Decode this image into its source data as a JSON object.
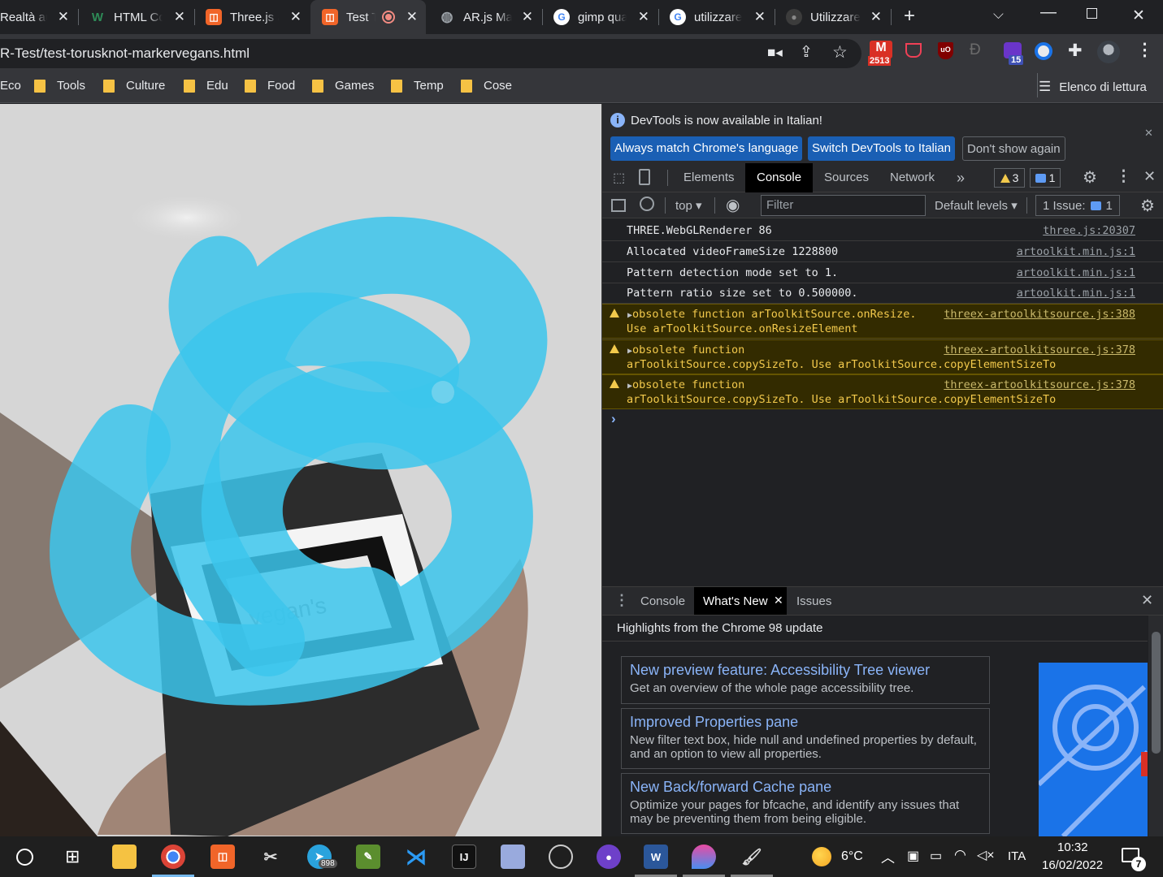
{
  "tabs": [
    {
      "title": "Realtà aumentata",
      "icon": "document-icon",
      "color": "#e8eaed"
    },
    {
      "title": "HTML Code",
      "icon": "w3-icon",
      "color": "#2e8b57"
    },
    {
      "title": "Three.js and",
      "icon": "three-icon",
      "color": "#f16529"
    },
    {
      "title": "Test TorusKnot",
      "icon": "three-icon",
      "color": "#f16529"
    },
    {
      "title": "AR.js Marker",
      "icon": "globe-icon",
      "color": "#9aa0a6"
    },
    {
      "title": "gimp quadrato",
      "icon": "google-icon",
      "color": "#4285f4"
    },
    {
      "title": "utilizzare",
      "icon": "google-icon",
      "color": "#4285f4"
    },
    {
      "title": "Utilizzare",
      "icon": "github-icon",
      "color": "#5f6368"
    }
  ],
  "address": {
    "url": "R-Test/test-torusknot-markervegans.html"
  },
  "extensions": {
    "gmail_badge": "2513",
    "ext_badge": "15"
  },
  "bookmarks": [
    {
      "label": "Eco"
    },
    {
      "label": "Tools"
    },
    {
      "label": "Culture"
    },
    {
      "label": "Edu"
    },
    {
      "label": "Food"
    },
    {
      "label": "Games"
    },
    {
      "label": "Temp"
    },
    {
      "label": "Cose"
    }
  ],
  "reading_list": "Elenco di lettura",
  "marker_text": "vegan's",
  "devtools": {
    "infobar": {
      "message": "DevTools is now available in Italian!",
      "btn_match": "Always match Chrome's language",
      "btn_switch": "Switch DevTools to Italian",
      "btn_dismiss": "Don't show again"
    },
    "tabs": [
      "Elements",
      "Console",
      "Sources",
      "Network"
    ],
    "warnings_count": "3",
    "messages_count": "1",
    "console_bar": {
      "context": "top",
      "filter_placeholder": "Filter",
      "levels": "Default levels",
      "issues_label": "1 Issue:",
      "issues_count": "1"
    },
    "logs": [
      {
        "message": "THREE.WebGLRenderer 86",
        "source": "three.js:20307"
      },
      {
        "message": "Allocated videoFrameSize 1228800",
        "source": "artoolkit.min.js:1"
      },
      {
        "message": "Pattern detection mode set to 1.",
        "source": "artoolkit.min.js:1"
      },
      {
        "message": "Pattern ratio size set to 0.500000.",
        "source": "artoolkit.min.js:1"
      }
    ],
    "warnings": [
      {
        "line1": "obsolete function arToolkitSource.onResize.",
        "line2": "Use arToolkitSource.onResizeElement",
        "source": "threex-artoolkitsource.js:388"
      },
      {
        "line1": "obsolete function",
        "line2": "arToolkitSource.copySizeTo. Use arToolkitSource.copyElementSizeTo",
        "source": "threex-artoolkitsource.js:378"
      },
      {
        "line1": "obsolete function",
        "line2": "arToolkitSource.copySizeTo. Use arToolkitSource.copyElementSizeTo",
        "source": "threex-artoolkitsource.js:378"
      }
    ],
    "prompt": "›",
    "drawer": {
      "tabs": [
        "Console",
        "What's New",
        "Issues"
      ],
      "highlight": "Highlights from the Chrome 98 update",
      "cards": [
        {
          "title": "New preview feature: Accessibility Tree viewer",
          "desc": "Get an overview of the whole page accessibility tree."
        },
        {
          "title": "Improved Properties pane",
          "desc": "New filter text box, hide null and undefined properties by default, and an option to view all properties."
        },
        {
          "title": "New Back/forward Cache pane",
          "desc": "Optimize your pages for bfcache, and identify any issues that may be preventing them from being eligible."
        }
      ]
    }
  },
  "taskbar": {
    "telegram_badge": "898",
    "weather": "6°C",
    "language": "ITA",
    "time": "10:32",
    "date": "16/02/2022",
    "notifications": "7"
  }
}
